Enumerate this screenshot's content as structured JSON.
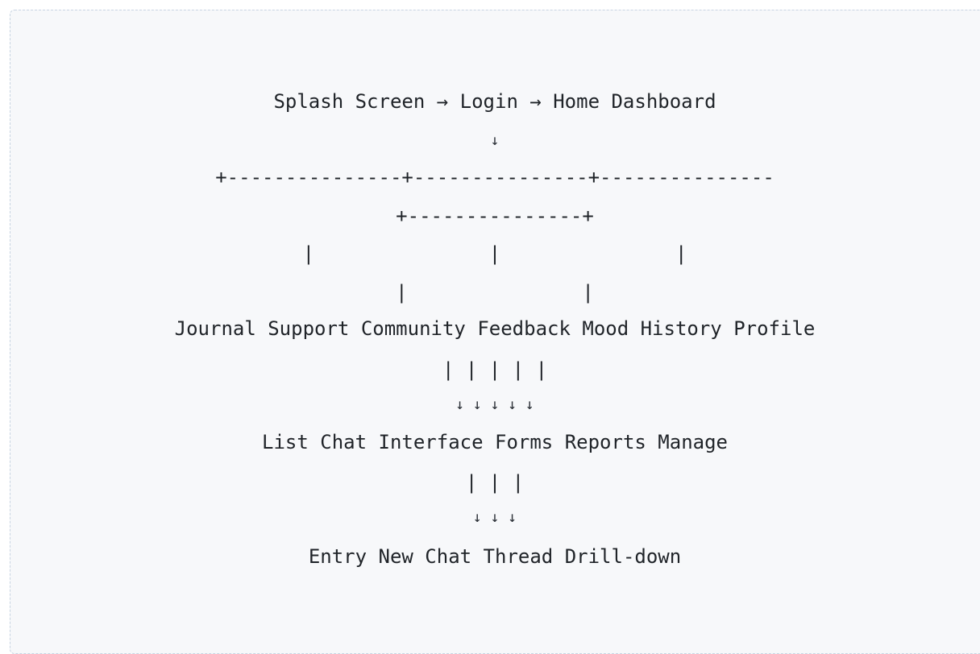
{
  "diagram": {
    "lines": [
      "Splash Screen → Login → Home Dashboard",
      "↓",
      "+---------------+---------------+---------------",
      "+---------------+",
      "|               |               |",
      "|               |",
      "Journal Support Community Feedback Mood History Profile",
      "| | | | |",
      "↓ ↓ ↓ ↓ ↓",
      "List Chat Interface Forms Reports Manage",
      "| | |",
      "↓ ↓ ↓",
      "Entry New Chat Thread Drill-down"
    ]
  }
}
